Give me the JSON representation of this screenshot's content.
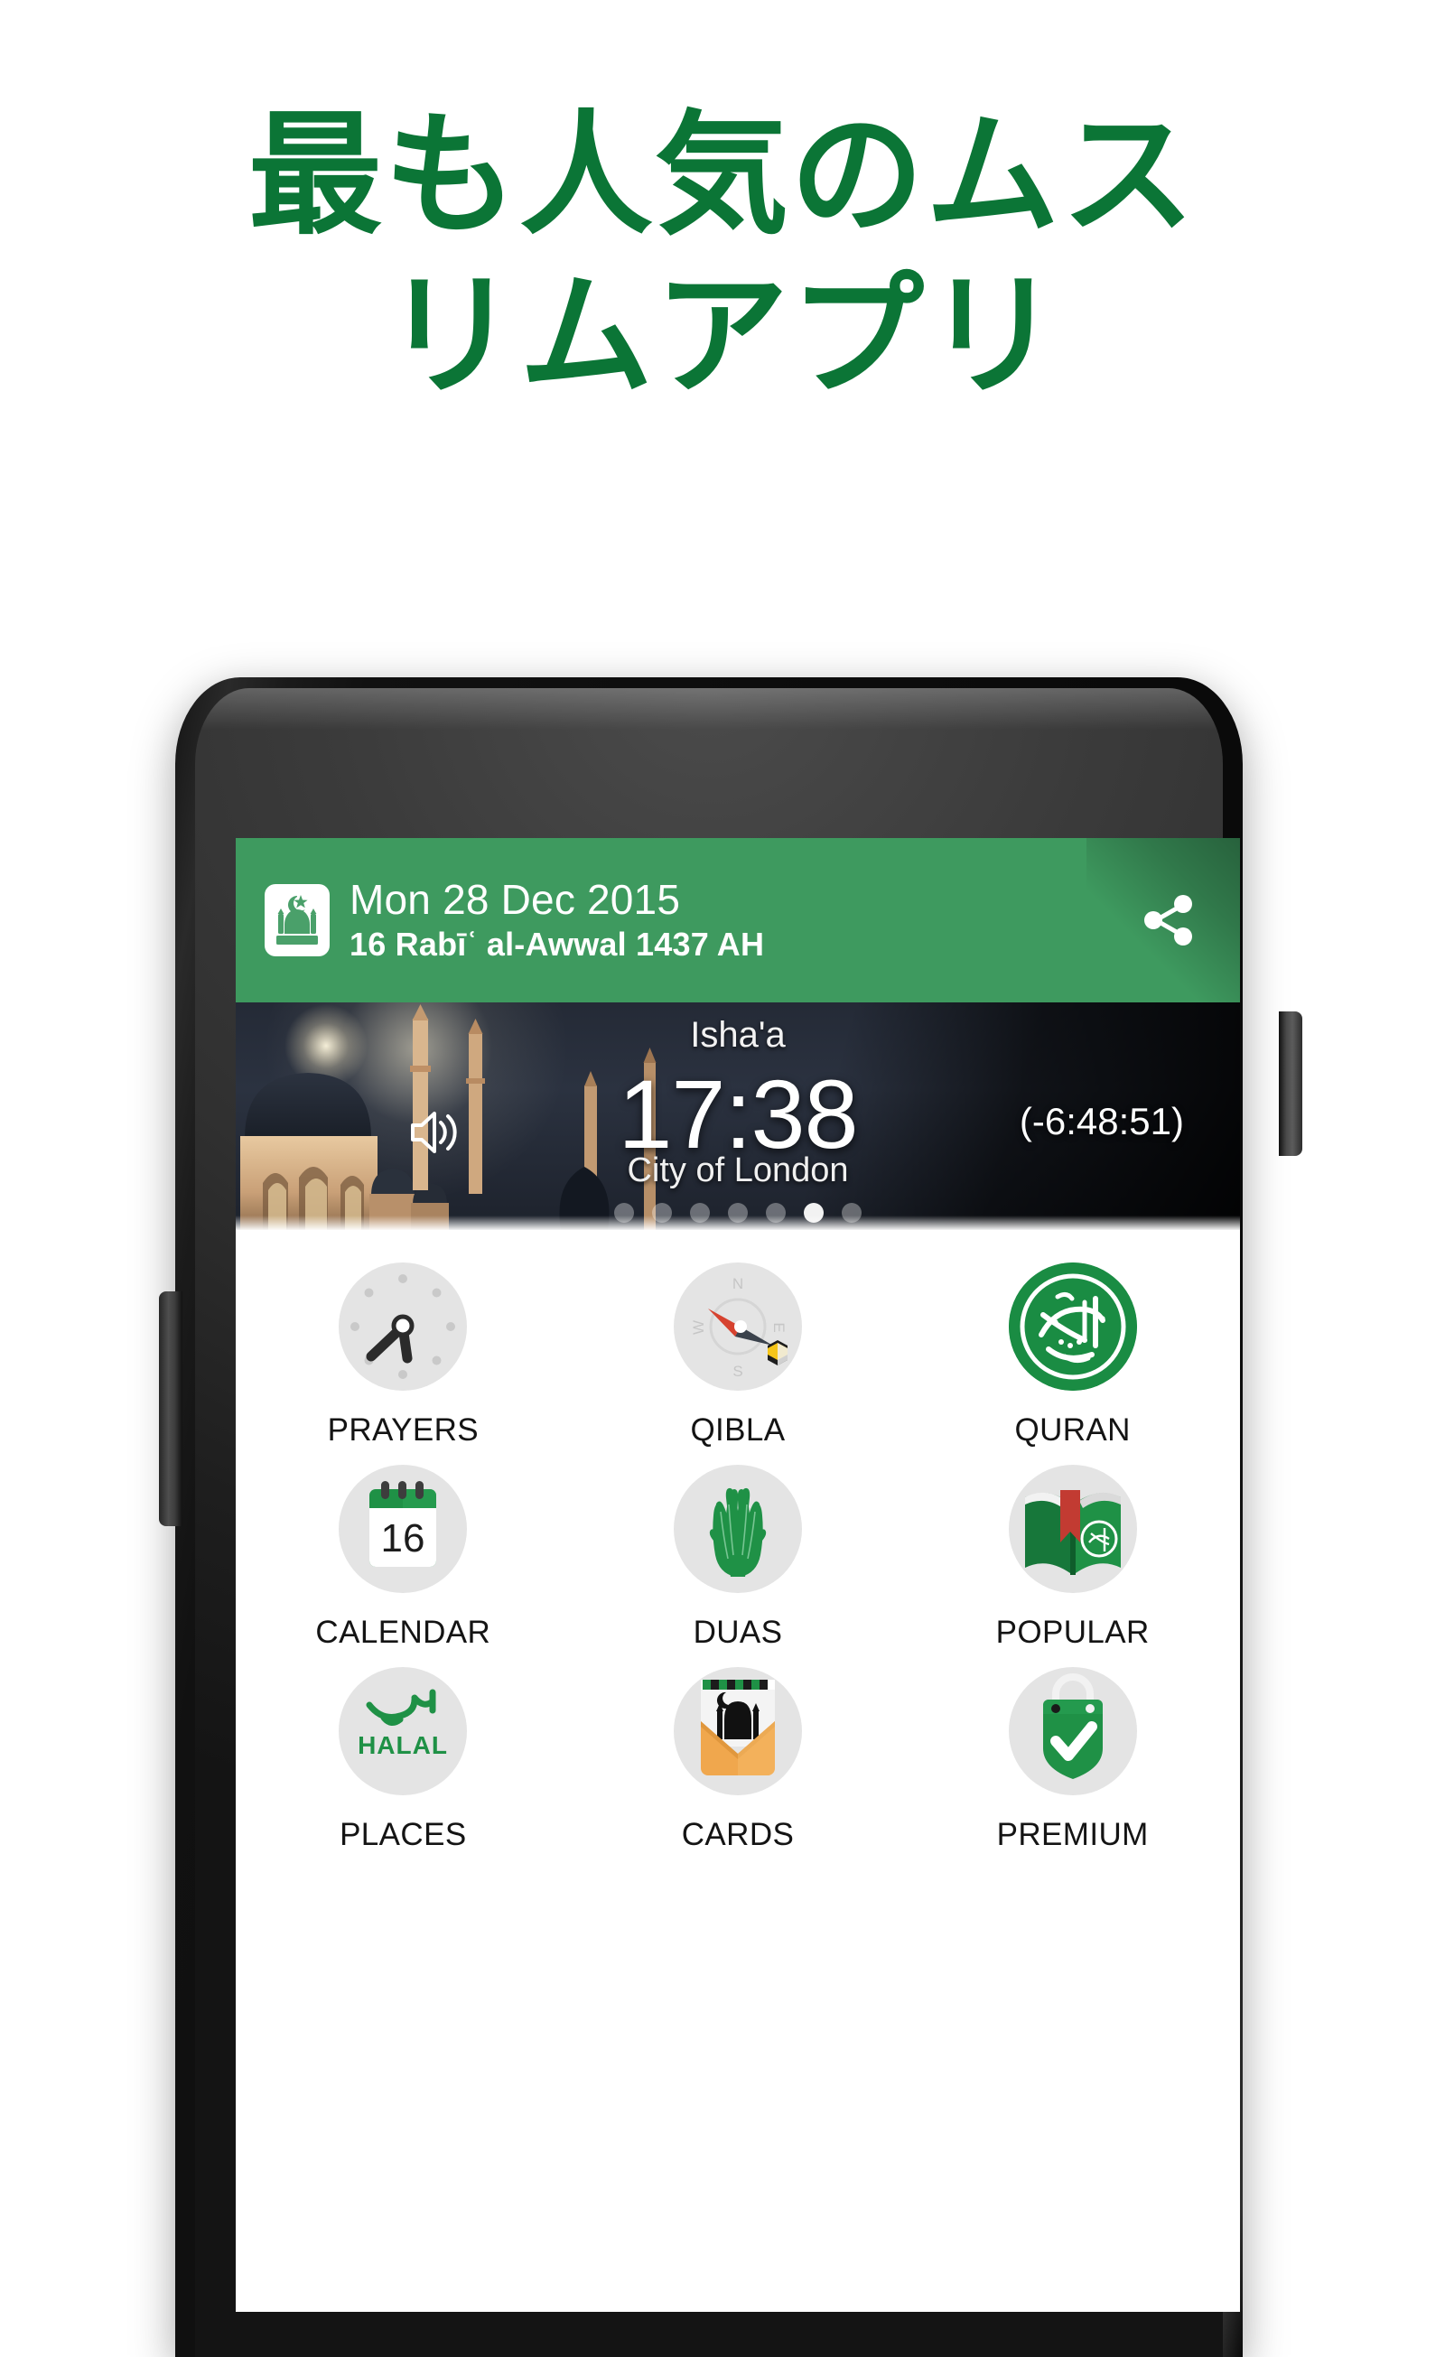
{
  "headline": {
    "line1": "最も人気のムス",
    "line2": "リムアプリ",
    "color": "#0B7536"
  },
  "phone": {
    "frame_color": "#111111",
    "camera_icon": "front-camera",
    "speaker_icon": "earpiece-speaker",
    "power_button": "power-button",
    "volume_button": "volume-button"
  },
  "app": {
    "accent_green": "#3E9A5F",
    "appbar": {
      "logo_icon": "mosque-logo-icon",
      "date_gregorian": "Mon 28 Dec 2015",
      "date_hijri": "16 Rabīʿ al-Awwal 1437 AH",
      "share_icon": "share-icon"
    },
    "hero": {
      "prayer_name": "Isha'a",
      "prayer_time": "17:38",
      "countdown": "(-6:48:51)",
      "location": "City of London",
      "volume_icon": "volume-up-icon",
      "pager": {
        "total": 7,
        "active_index": 5
      }
    },
    "grid": {
      "items": [
        {
          "label": "PRAYERS",
          "icon": "clock-icon",
          "style": "grey"
        },
        {
          "label": "QIBLA",
          "icon": "compass-icon",
          "style": "grey"
        },
        {
          "label": "QURAN",
          "icon": "quran-calligraphy-icon",
          "style": "green"
        },
        {
          "label": "CALENDAR",
          "icon": "calendar-16-icon",
          "style": "grey"
        },
        {
          "label": "DUAS",
          "icon": "praying-hands-icon",
          "style": "grey"
        },
        {
          "label": "POPULAR",
          "icon": "open-book-icon",
          "style": "grey"
        },
        {
          "label": "PLACES",
          "icon": "halal-icon",
          "style": "grey"
        },
        {
          "label": "CARDS",
          "icon": "greeting-card-mosque-icon",
          "style": "grey"
        },
        {
          "label": "PREMIUM",
          "icon": "price-tag-check-icon",
          "style": "grey"
        }
      ]
    }
  }
}
